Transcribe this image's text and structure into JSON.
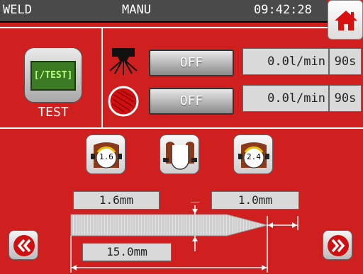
{
  "status": {
    "mode": "WELD",
    "submode": "MANU",
    "time": "09:42:28"
  },
  "test": {
    "screen_label": "[/TEST]",
    "label": "TEST"
  },
  "rows": [
    {
      "button": "OFF",
      "flow": "0.0l/min",
      "time": "90s"
    },
    {
      "button": "OFF",
      "flow": "0.0l/min",
      "time": "90s"
    }
  ],
  "gauges": [
    {
      "value": "1.6"
    },
    {
      "value": ""
    },
    {
      "value": "2.4"
    }
  ],
  "dimensions": {
    "top_left": "1.6mm",
    "top_right": "1.0mm",
    "bottom": "15.0mm"
  },
  "icons": {
    "home": "home-icon",
    "prev": "double-chevron-left-icon",
    "next": "double-chevron-right-icon",
    "gas": "gas-spray-icon",
    "wire": "wire-spool-icon"
  },
  "colors": {
    "background": "#cf1f1f",
    "statusbar": "#4a4a4a",
    "accent": "#cc1111"
  }
}
